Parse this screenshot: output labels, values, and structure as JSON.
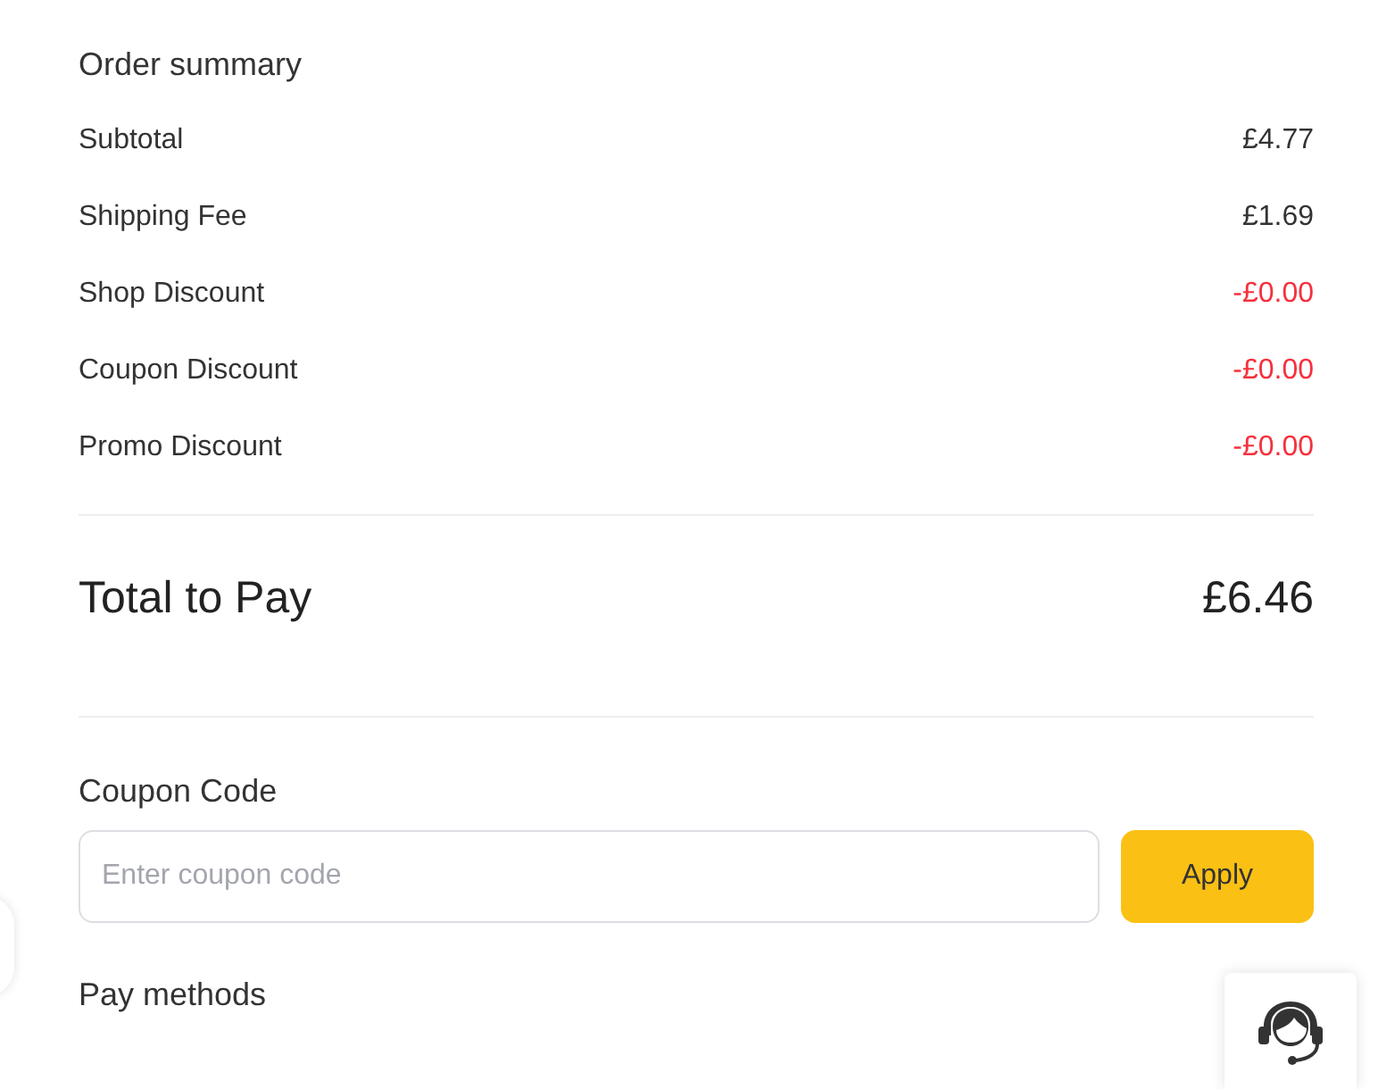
{
  "title": "Order summary",
  "lines": [
    {
      "label": "Subtotal",
      "amount": "£4.77",
      "kind": "charge"
    },
    {
      "label": "Shipping Fee",
      "amount": "£1.69",
      "kind": "charge"
    },
    {
      "label": "Shop Discount",
      "amount": "-£0.00",
      "kind": "discount"
    },
    {
      "label": "Coupon Discount",
      "amount": "-£0.00",
      "kind": "discount"
    },
    {
      "label": "Promo Discount",
      "amount": "-£0.00",
      "kind": "discount"
    }
  ],
  "total": {
    "label": "Total to Pay",
    "amount": "£6.46"
  },
  "coupon": {
    "label": "Coupon Code",
    "placeholder": "Enter coupon code",
    "button": "Apply"
  },
  "pay_methods": {
    "title": "Pay methods"
  }
}
